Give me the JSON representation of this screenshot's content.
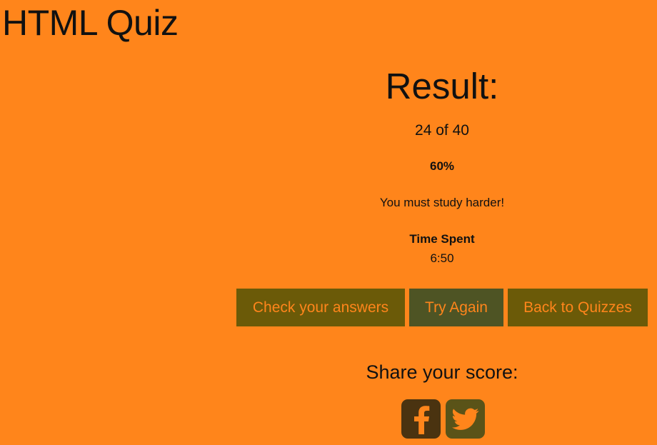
{
  "page": {
    "title": "HTML Quiz"
  },
  "result": {
    "heading": "Result:",
    "score": "24 of 40",
    "percent": "60%",
    "message": "You must study harder!",
    "time_label": "Time Spent",
    "time_value": "6:50"
  },
  "actions": {
    "check_label": "Check your answers",
    "try_again_label": "Try Again",
    "back_label": "Back to Quizzes"
  },
  "share": {
    "heading": "Share your score:",
    "icons": [
      "facebook-icon",
      "twitter-icon"
    ]
  },
  "colors": {
    "background": "#FF851B",
    "button_bg": "#6B5A08",
    "button_active_bg": "#4E5424",
    "button_text": "#FF851B",
    "facebook_bg": "#4A3310",
    "twitter_bg": "#5A5318"
  }
}
